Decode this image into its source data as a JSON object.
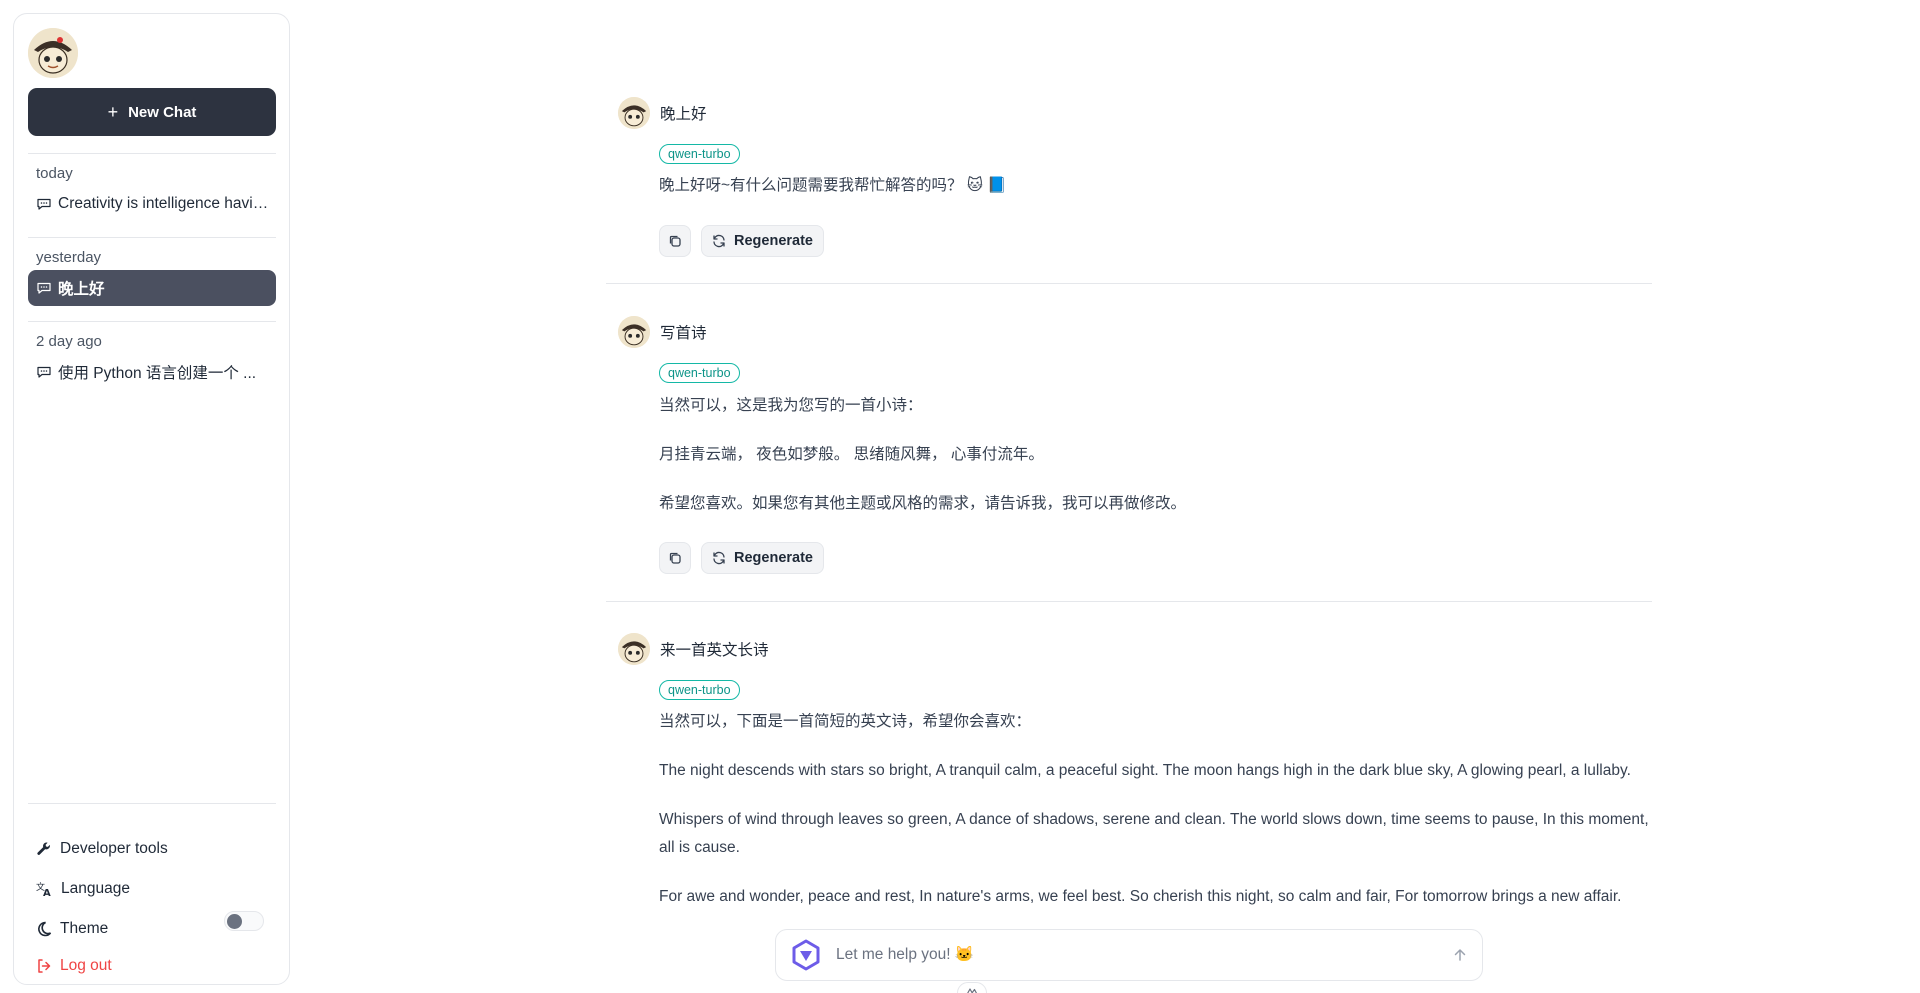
{
  "sidebar": {
    "new_chat_label": "New Chat",
    "groups": [
      {
        "label": "today",
        "items": [
          {
            "title": "Creativity is intelligence having fun",
            "active": false
          }
        ]
      },
      {
        "label": "yesterday",
        "items": [
          {
            "title": "晚上好",
            "active": true
          }
        ]
      },
      {
        "label": "2 day ago",
        "items": [
          {
            "title": "使用 Python 语言创建一个 ...",
            "active": false
          }
        ]
      }
    ],
    "menu": {
      "developer_tools": "Developer tools",
      "language": "Language",
      "theme": "Theme",
      "logout": "Log out"
    },
    "theme_toggle_on": false
  },
  "messages": [
    {
      "user": "晚上好",
      "model": "qwen-turbo",
      "paragraphs": [
        "晚上好呀~有什么问题需要我帮忙解答的吗？ 🐱 📘"
      ],
      "regenerate_label": "Regenerate"
    },
    {
      "user": "写首诗",
      "model": "qwen-turbo",
      "paragraphs": [
        "当然可以，这是我为您写的一首小诗：",
        "月挂青云端， 夜色如梦般。 思绪随风舞， 心事付流年。",
        "希望您喜欢。如果您有其他主题或风格的需求，请告诉我，我可以再做修改。"
      ],
      "regenerate_label": "Regenerate"
    },
    {
      "user": "来一首英文长诗",
      "model": "qwen-turbo",
      "paragraphs": [
        "当然可以，下面是一首简短的英文诗，希望你会喜欢：",
        "The night descends with stars so bright, A tranquil calm, a peaceful sight. The moon hangs high in the dark blue sky, A glowing pearl, a lullaby.",
        "Whispers of wind through leaves so green, A dance of shadows, serene and clean. The world slows down, time seems to pause, In this moment, all is cause.",
        "For awe and wonder, peace and rest, In nature's arms, we feel best. So cherish this night, so calm and fair, For tomorrow brings a new affair."
      ]
    }
  ],
  "input": {
    "placeholder": "Let me help you! 🐱"
  },
  "colors": {
    "accent_dark": "#2d3340",
    "active_item": "#4b5060",
    "model_tag": "#14b8a6",
    "logout": "#ef4444"
  }
}
